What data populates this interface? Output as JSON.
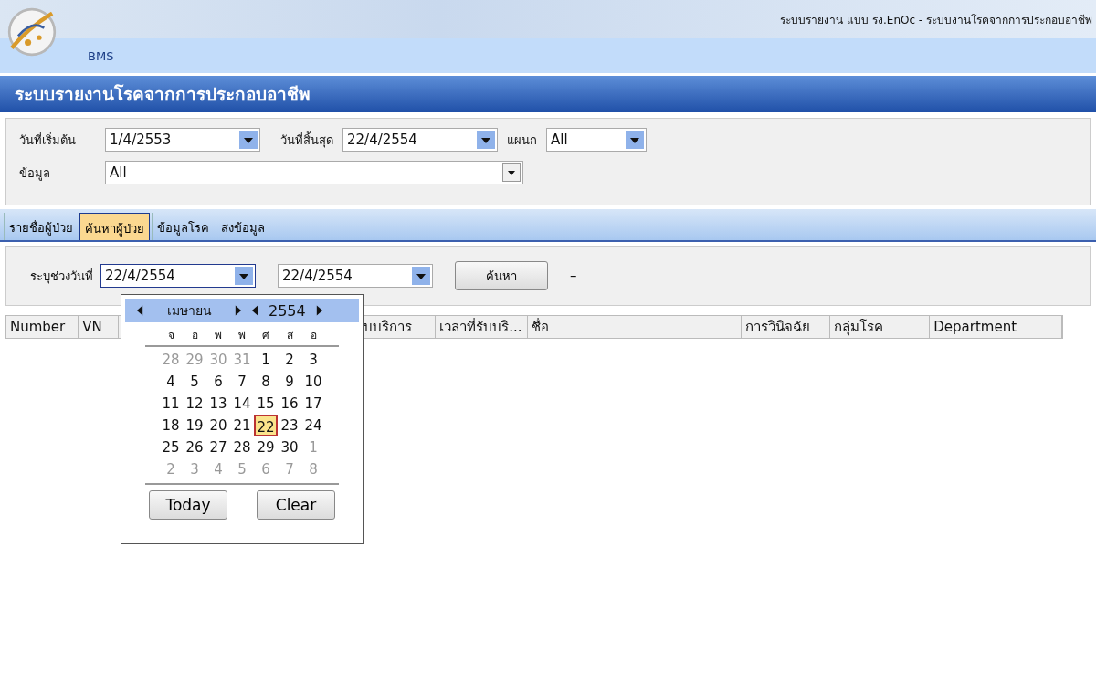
{
  "window": {
    "title": "ระบบรายงาน แบบ รง.EnOc - ระบบงานโรคจากการประกอบอาชีพ"
  },
  "app_name": "BMS",
  "header": {
    "title": "ระบบรายงานโรคจากการประกอบอาชีพ"
  },
  "filters": [
    {
      "label": "วันที่เริ่มต้น",
      "value": "1/4/2553",
      "kind": "date"
    },
    {
      "label": "วันที่สิ้นสุด",
      "value": "22/4/2554",
      "kind": "date"
    },
    {
      "label": "แผนก",
      "value": "All",
      "kind": "small"
    },
    {
      "label": "ข้อมูล",
      "value": "All",
      "kind": "wide"
    }
  ],
  "tabs": [
    {
      "label": "รายชื่อผู้ป่วย",
      "selected": false
    },
    {
      "label": "ค้นหาผู้ป่วย",
      "selected": true
    },
    {
      "label": "ข้อมูลโรค",
      "selected": false
    },
    {
      "label": "ส่งข้อมูล",
      "selected": false
    }
  ],
  "search": {
    "label": "ระบุช่วงวันที่",
    "from": "22/4/2554",
    "to": "22/4/2554",
    "button": "ค้นหา",
    "separator": "–"
  },
  "table": {
    "columns": [
      "Number",
      "VN",
      "บบริการ",
      "เวลาที่รับบริ...",
      "ชื่อ",
      "การวินิจฉัย",
      "กลุ่มโรค",
      "Department"
    ]
  },
  "calendar": {
    "month": "เมษายน",
    "year": "2554",
    "weekdays": [
      "จ",
      "อ",
      "พ",
      "พ",
      "ศ",
      "ส",
      "อ"
    ],
    "days": [
      {
        "day": "28",
        "outside": true,
        "selected": false
      },
      {
        "day": "29",
        "outside": true,
        "selected": false
      },
      {
        "day": "30",
        "outside": true,
        "selected": false
      },
      {
        "day": "31",
        "outside": true,
        "selected": false
      },
      {
        "day": "1",
        "outside": false,
        "selected": false
      },
      {
        "day": "2",
        "outside": false,
        "selected": false
      },
      {
        "day": "3",
        "outside": false,
        "selected": false
      },
      {
        "day": "4",
        "outside": false,
        "selected": false
      },
      {
        "day": "5",
        "outside": false,
        "selected": false
      },
      {
        "day": "6",
        "outside": false,
        "selected": false
      },
      {
        "day": "7",
        "outside": false,
        "selected": false
      },
      {
        "day": "8",
        "outside": false,
        "selected": false
      },
      {
        "day": "9",
        "outside": false,
        "selected": false
      },
      {
        "day": "10",
        "outside": false,
        "selected": false
      },
      {
        "day": "11",
        "outside": false,
        "selected": false
      },
      {
        "day": "12",
        "outside": false,
        "selected": false
      },
      {
        "day": "13",
        "outside": false,
        "selected": false
      },
      {
        "day": "14",
        "outside": false,
        "selected": false
      },
      {
        "day": "15",
        "outside": false,
        "selected": false
      },
      {
        "day": "16",
        "outside": false,
        "selected": false
      },
      {
        "day": "17",
        "outside": false,
        "selected": false
      },
      {
        "day": "18",
        "outside": false,
        "selected": false
      },
      {
        "day": "19",
        "outside": false,
        "selected": false
      },
      {
        "day": "20",
        "outside": false,
        "selected": false
      },
      {
        "day": "21",
        "outside": false,
        "selected": false
      },
      {
        "day": "22",
        "outside": false,
        "selected": true
      },
      {
        "day": "23",
        "outside": false,
        "selected": false
      },
      {
        "day": "24",
        "outside": false,
        "selected": false
      },
      {
        "day": "25",
        "outside": false,
        "selected": false
      },
      {
        "day": "26",
        "outside": false,
        "selected": false
      },
      {
        "day": "27",
        "outside": false,
        "selected": false
      },
      {
        "day": "28",
        "outside": false,
        "selected": false
      },
      {
        "day": "29",
        "outside": false,
        "selected": false
      },
      {
        "day": "30",
        "outside": false,
        "selected": false
      },
      {
        "day": "1",
        "outside": true,
        "selected": false
      },
      {
        "day": "2",
        "outside": true,
        "selected": false
      },
      {
        "day": "3",
        "outside": true,
        "selected": false
      },
      {
        "day": "4",
        "outside": true,
        "selected": false
      },
      {
        "day": "5",
        "outside": true,
        "selected": false
      },
      {
        "day": "6",
        "outside": true,
        "selected": false
      },
      {
        "day": "7",
        "outside": true,
        "selected": false
      },
      {
        "day": "8",
        "outside": true,
        "selected": false
      }
    ],
    "buttons": [
      "Today",
      "Clear"
    ]
  }
}
